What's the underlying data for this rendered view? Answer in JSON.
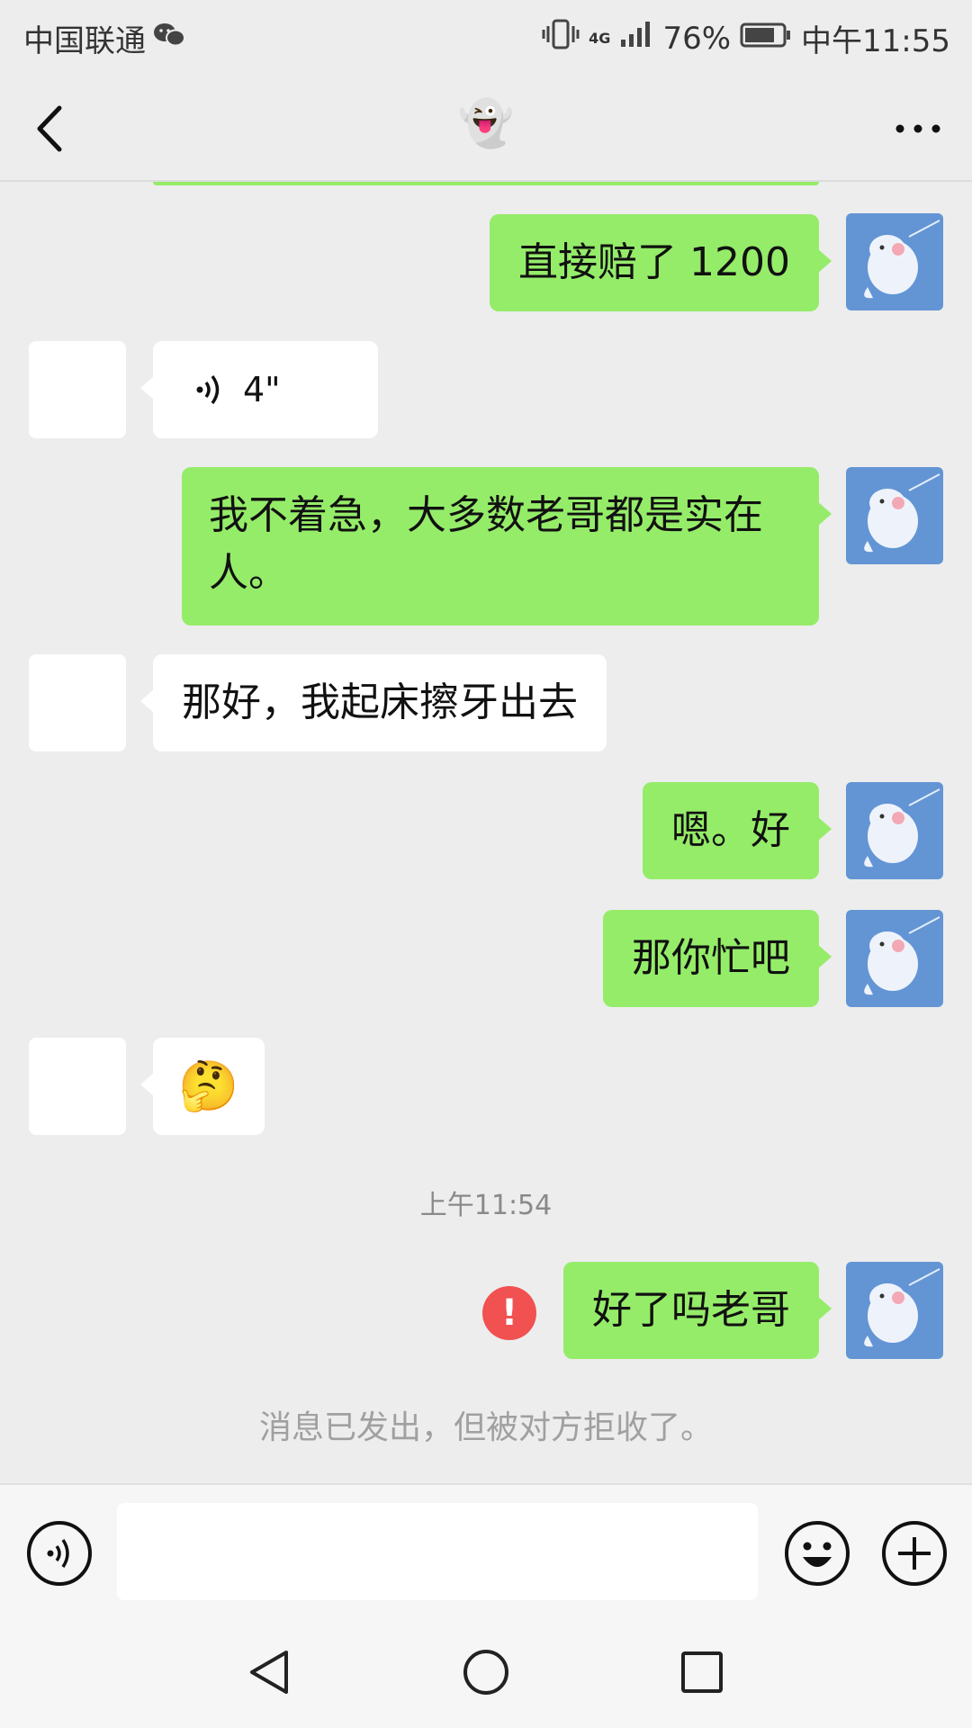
{
  "status_bar": {
    "carrier": "中国联通",
    "network": "4G",
    "battery": "76%",
    "time": "中午11:55"
  },
  "header": {
    "title": "👻",
    "back_icon": "chevron-left-icon",
    "more_icon": "more-icon"
  },
  "messages": [
    {
      "side": "me",
      "text": "直接赔了 1200"
    },
    {
      "side": "other",
      "type": "voice",
      "duration": "4\""
    },
    {
      "side": "me",
      "text": "我不着急，大多数老哥都是实在人。"
    },
    {
      "side": "other",
      "text": "那好，我起床擦牙出去"
    },
    {
      "side": "me",
      "text": "嗯。好"
    },
    {
      "side": "me",
      "text": "那你忙吧"
    },
    {
      "side": "other",
      "type": "emoji",
      "text": "🤔"
    },
    {
      "side": "me",
      "text": "好了吗老哥",
      "status": "failed"
    }
  ],
  "timestamp": "上午11:54",
  "error_mark": "!",
  "system_notice": "消息已发出，但被对方拒收了。",
  "input": {
    "value": "",
    "placeholder": ""
  },
  "colors": {
    "my_bubble": "#95ec69",
    "other_bubble": "#ffffff",
    "error": "#f15151",
    "my_avatar": "#6395d5"
  }
}
